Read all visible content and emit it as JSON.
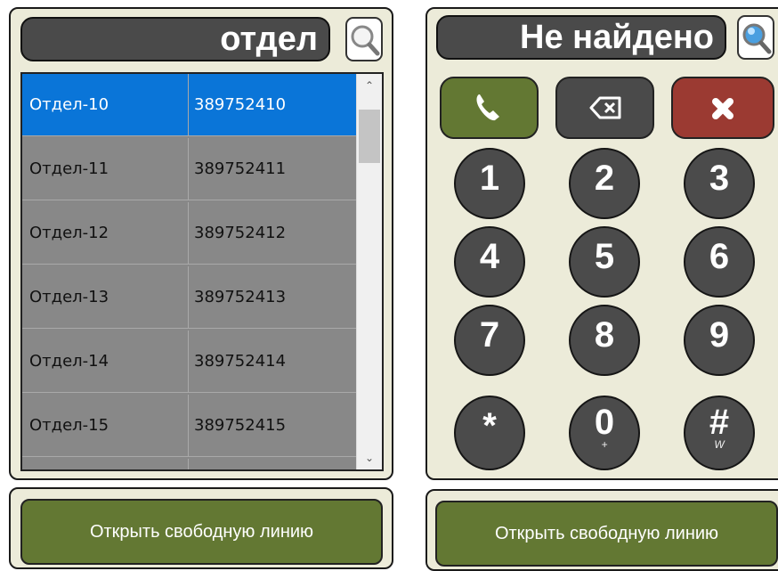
{
  "left_panel": {
    "search_value": "отдел",
    "contacts": [
      {
        "name": "Отдел-10",
        "number": "389752410",
        "selected": true
      },
      {
        "name": "Отдел-11",
        "number": "389752411",
        "selected": false
      },
      {
        "name": "Отдел-12",
        "number": "389752412",
        "selected": false
      },
      {
        "name": "Отдел-13",
        "number": "389752413",
        "selected": false
      },
      {
        "name": "Отдел-14",
        "number": "389752414",
        "selected": false
      },
      {
        "name": "Отдел-15",
        "number": "389752415",
        "selected": false
      }
    ],
    "open_line_button": "Открыть свободную линию"
  },
  "right_panel": {
    "display_value": "Не найдено",
    "actions": [
      {
        "name": "call",
        "icon": "phone-icon",
        "color": "#637833"
      },
      {
        "name": "backspace",
        "icon": "backspace-icon",
        "color": "#4a4a4a"
      },
      {
        "name": "hangup",
        "icon": "close-icon",
        "color": "#9b3a32"
      }
    ],
    "keys": [
      {
        "digit": "1",
        "sub": ""
      },
      {
        "digit": "2",
        "sub": ""
      },
      {
        "digit": "3",
        "sub": ""
      },
      {
        "digit": "4",
        "sub": ""
      },
      {
        "digit": "5",
        "sub": ""
      },
      {
        "digit": "6",
        "sub": ""
      },
      {
        "digit": "7",
        "sub": ""
      },
      {
        "digit": "8",
        "sub": ""
      },
      {
        "digit": "9",
        "sub": ""
      },
      {
        "digit": "*",
        "sub": ""
      },
      {
        "digit": "0",
        "sub": "+"
      },
      {
        "digit": "#",
        "sub": "W"
      }
    ],
    "open_line_button": "Открыть свободную линию"
  },
  "colors": {
    "panel_bg": "#ecebd9",
    "selected_row": "#0a75d8",
    "row_bg": "#888888",
    "key_bg": "#4b4b4b",
    "green": "#637833",
    "red": "#9b3a32"
  }
}
